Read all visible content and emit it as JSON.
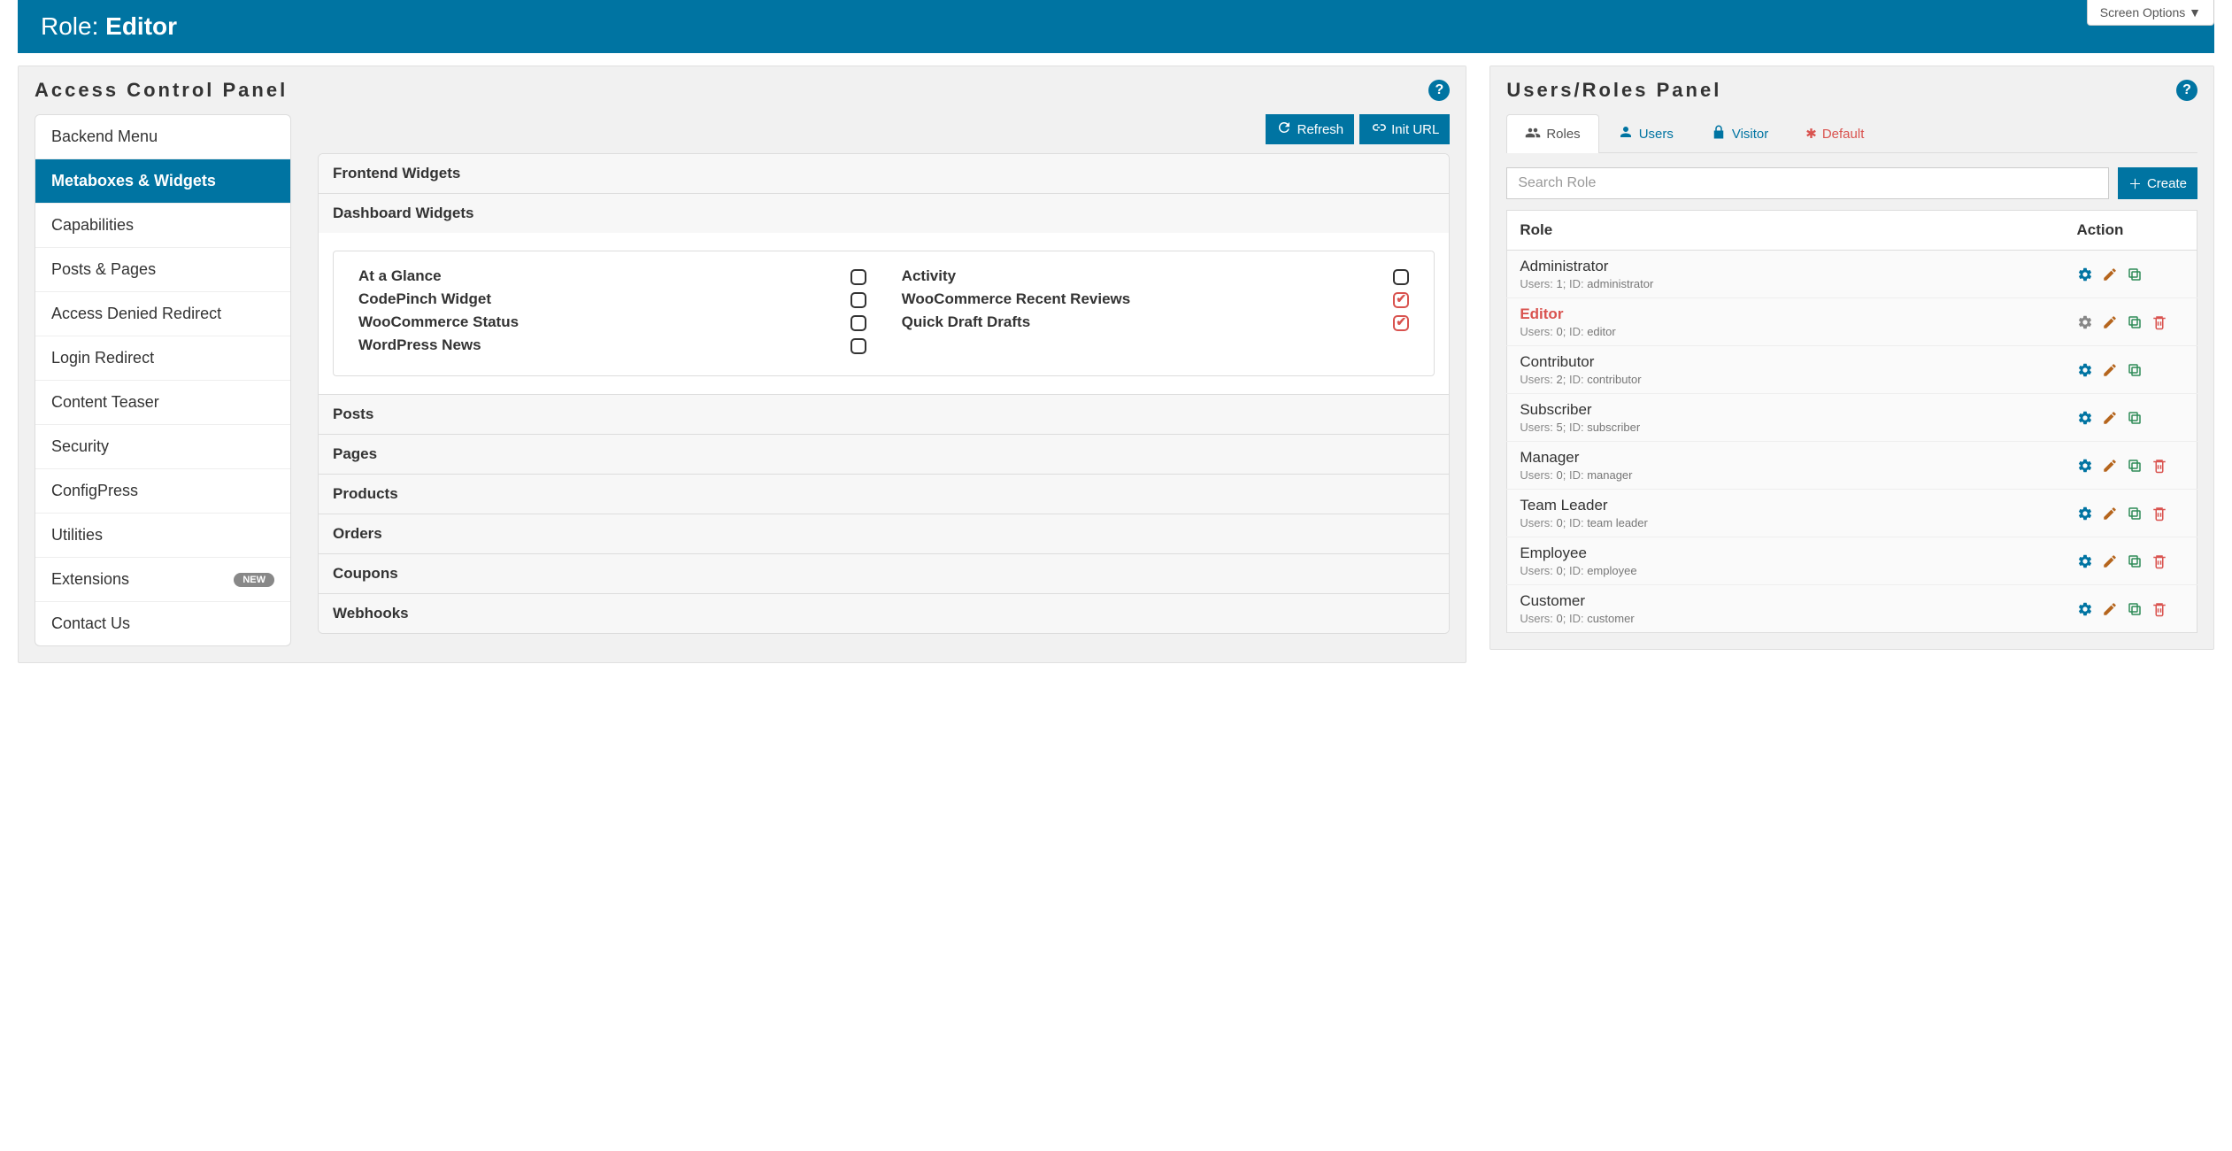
{
  "screen_options": "Screen Options ▼",
  "title": {
    "prefix": "Role: ",
    "name": "Editor"
  },
  "acp": {
    "title": "Access Control Panel",
    "refresh": "Refresh",
    "init_url": "Init URL",
    "sidebar": [
      "Backend Menu",
      "Metaboxes & Widgets",
      "Capabilities",
      "Posts & Pages",
      "Access Denied Redirect",
      "Login Redirect",
      "Content Teaser",
      "Security",
      "ConfigPress",
      "Utilities",
      "Extensions",
      "Contact Us"
    ],
    "new_badge": "NEW",
    "sections": {
      "frontend": "Frontend Widgets",
      "dashboard": "Dashboard Widgets",
      "posts": "Posts",
      "pages": "Pages",
      "products": "Products",
      "orders": "Orders",
      "coupons": "Coupons",
      "webhooks": "Webhooks"
    },
    "widgets_left": [
      {
        "label": "At a Glance",
        "checked": false
      },
      {
        "label": "CodePinch Widget",
        "checked": false
      },
      {
        "label": "WooCommerce Status",
        "checked": false
      },
      {
        "label": "WordPress News",
        "checked": false
      }
    ],
    "widgets_right": [
      {
        "label": "Activity",
        "checked": false
      },
      {
        "label": "WooCommerce Recent Reviews",
        "checked": true
      },
      {
        "label": "Quick Draft Drafts",
        "checked": true
      }
    ]
  },
  "urp": {
    "title": "Users/Roles Panel",
    "tabs": {
      "roles": "Roles",
      "users": "Users",
      "visitor": "Visitor",
      "default": "Default"
    },
    "search_placeholder": "Search Role",
    "create": "Create",
    "th_role": "Role",
    "th_action": "Action",
    "meta_users": "Users: ",
    "meta_id": "; ID: ",
    "roles": [
      {
        "name": "Administrator",
        "users": "1",
        "id": "administrator",
        "current": false,
        "deletable": false
      },
      {
        "name": "Editor",
        "users": "0",
        "id": "editor",
        "current": true,
        "deletable": true
      },
      {
        "name": "Contributor",
        "users": "2",
        "id": "contributor",
        "current": false,
        "deletable": false
      },
      {
        "name": "Subscriber",
        "users": "5",
        "id": "subscriber",
        "current": false,
        "deletable": false
      },
      {
        "name": "Manager",
        "users": "0",
        "id": "manager",
        "current": false,
        "deletable": true
      },
      {
        "name": "Team Leader",
        "users": "0",
        "id": "team leader",
        "current": false,
        "deletable": true
      },
      {
        "name": "Employee",
        "users": "0",
        "id": "employee",
        "current": false,
        "deletable": true
      },
      {
        "name": "Customer",
        "users": "0",
        "id": "customer",
        "current": false,
        "deletable": true
      }
    ]
  }
}
